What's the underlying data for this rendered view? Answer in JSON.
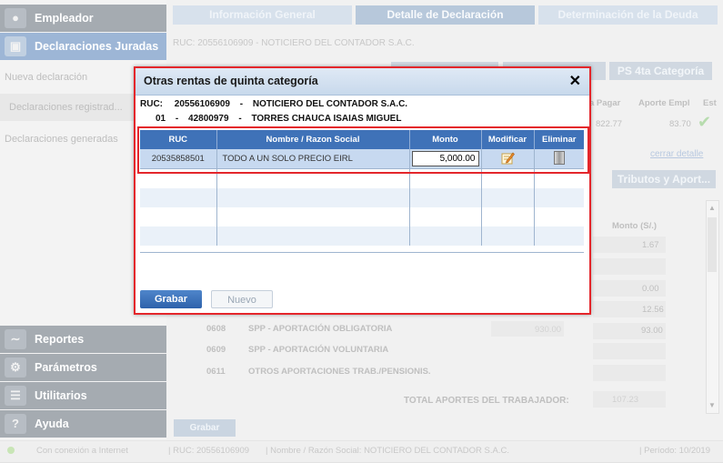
{
  "sidebar": {
    "empleador": "Empleador",
    "declaraciones": "Declaraciones Juradas",
    "nueva": "Nueva declaración",
    "registradas": "Declaraciones registrad...",
    "generadas": "Declaraciones generadas",
    "reportes": "Reportes",
    "parametros": "Parámetros",
    "utilitarios": "Utilitarios",
    "ayuda": "Ayuda"
  },
  "tabs": {
    "informacion": "Información General",
    "detalle": "Detalle de Declaración",
    "determinacion": "Determinación de la Deuda"
  },
  "background": {
    "ruc_line": "RUC:  20556106909   -   NOTICIERO DEL CONTADOR S.A.C.",
    "ps4ta": "PS 4ta Categoría",
    "col_pagar": "a Pagar",
    "col_aporte": "Aporte Empl",
    "col_est": "Est",
    "val_pagar": "822.77",
    "val_aporte": "83.70",
    "cerrar": "cerrar detalle",
    "tributos": "Tributos y Aport...",
    "monto_hdr": "Monto (S/.)",
    "m1": "1.67",
    "m2": "0.00",
    "m3": "12.56",
    "m4": "93.00",
    "code1": "0608",
    "desc1": "SPP - APORTACIÓN OBLIGATORIA",
    "val1": "930.00",
    "code2": "0609",
    "desc2": "SPP - APORTACIÓN VOLUNTARIA",
    "code3": "0611",
    "desc3": "OTROS APORTACIONES TRAB./PENSIONIS.",
    "total_label": "TOTAL APORTES DEL TRABAJADOR:",
    "total_val": "107.23",
    "grabar": "Grabar"
  },
  "status": {
    "conexion": "Con conexión a Internet",
    "ruc": "| RUC: 20556106909",
    "nombre": "| Nombre / Razón Social: NOTICIERO DEL CONTADOR S.A.C.",
    "periodo": "| Período: 10/2019"
  },
  "modal": {
    "title": "Otras rentas de quinta categoría",
    "close": "✕",
    "ruc_label": "RUC:",
    "ruc_value": "20556106909",
    "sep": "-",
    "company": "NOTICIERO DEL CONTADOR S.A.C.",
    "doc_type": "01",
    "doc_number": "42800979",
    "worker": "TORRES CHAUCA ISAIAS MIGUEL",
    "columns": {
      "ruc": "RUC",
      "nombre": "Nombre / Razon Social",
      "monto": "Monto",
      "modificar": "Modificar",
      "eliminar": "Eliminar"
    },
    "row": {
      "ruc": "20535858501",
      "nombre": "TODO A UN SOLO PRECIO EIRL",
      "monto": "5,000.00"
    },
    "grabar": "Grabar",
    "nuevo": "Nuevo"
  },
  "icons": {
    "edit": "pencil-edit-icon",
    "delete": "trash-icon"
  },
  "colors": {
    "accent": "#3f72b8",
    "highlight": "#e4262b"
  }
}
